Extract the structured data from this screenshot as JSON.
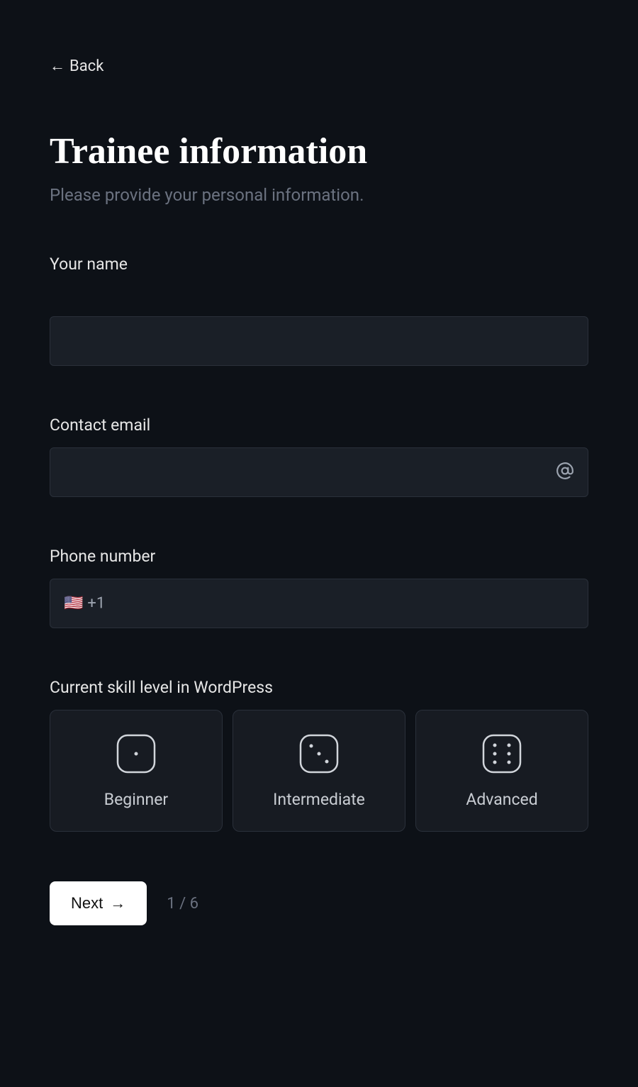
{
  "back": {
    "label": "Back"
  },
  "header": {
    "title": "Trainee information",
    "subtitle": "Please provide your personal information."
  },
  "fields": {
    "name": {
      "label": "Your name",
      "value": ""
    },
    "email": {
      "label": "Contact email",
      "value": ""
    },
    "phone": {
      "label": "Phone number",
      "value": "",
      "prefix": "+1",
      "flag": "🇺🇸"
    },
    "skill": {
      "label": "Current skill level in WordPress",
      "options": [
        "Beginner",
        "Intermediate",
        "Advanced"
      ]
    }
  },
  "footer": {
    "next_label": "Next",
    "step_current": "1",
    "step_total": "6",
    "step_separator": " / "
  }
}
